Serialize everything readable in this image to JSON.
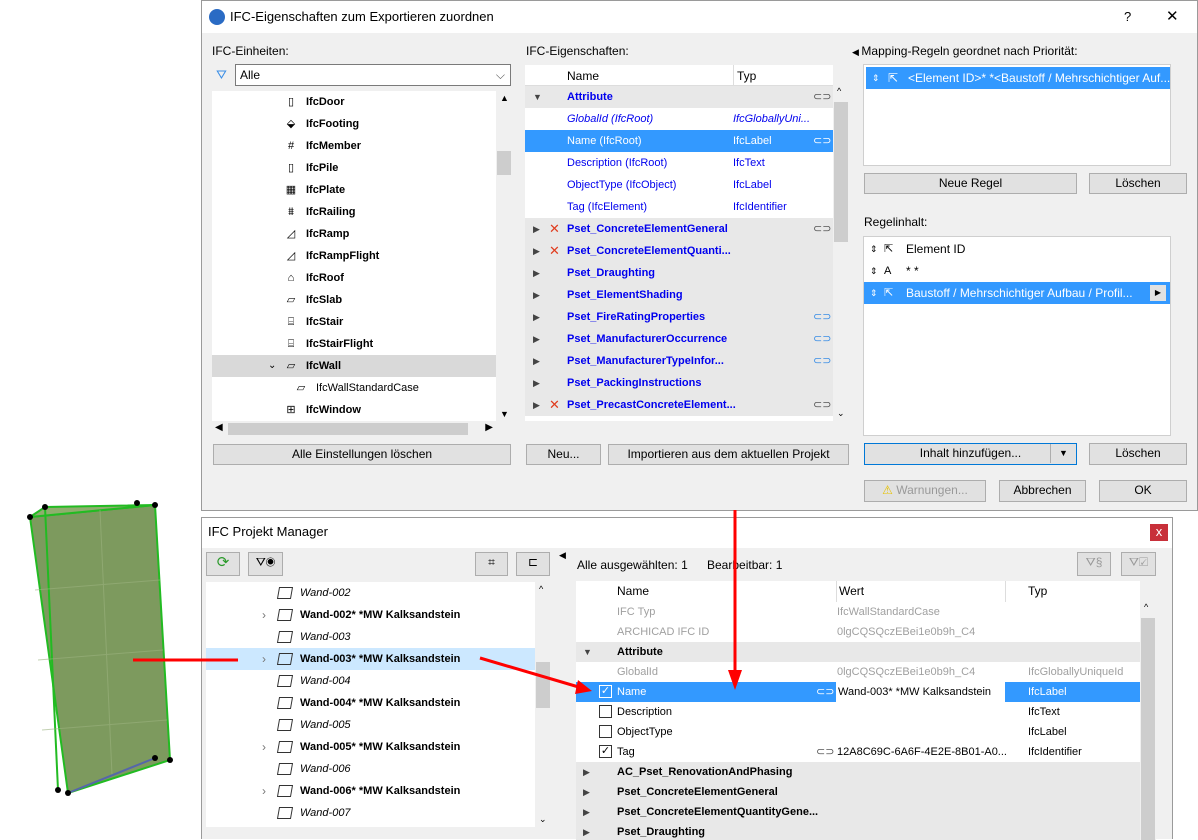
{
  "dialog1": {
    "title": "IFC-Eigenschaften zum Exportieren zuordnen",
    "help": "?",
    "close": "✕",
    "units": {
      "label": "IFC-Einheiten:",
      "filter_value": "Alle",
      "items": [
        {
          "label": "IfcDoor",
          "icon": "door-icon",
          "glyph": "▯"
        },
        {
          "label": "IfcFooting",
          "icon": "footing-icon",
          "glyph": "⬙"
        },
        {
          "label": "IfcMember",
          "icon": "member-icon",
          "glyph": "#"
        },
        {
          "label": "IfcPile",
          "icon": "pile-icon",
          "glyph": "▯"
        },
        {
          "label": "IfcPlate",
          "icon": "plate-icon",
          "glyph": "▦"
        },
        {
          "label": "IfcRailing",
          "icon": "railing-icon",
          "glyph": "⩩"
        },
        {
          "label": "IfcRamp",
          "icon": "ramp-icon",
          "glyph": "◿"
        },
        {
          "label": "IfcRampFlight",
          "icon": "ramp-flight-icon",
          "glyph": "◿"
        },
        {
          "label": "IfcRoof",
          "icon": "roof-icon",
          "glyph": "⌂"
        },
        {
          "label": "IfcSlab",
          "icon": "slab-icon",
          "glyph": "▱"
        },
        {
          "label": "IfcStair",
          "icon": "stair-icon",
          "glyph": "⌸"
        },
        {
          "label": "IfcStairFlight",
          "icon": "stair-flight-icon",
          "glyph": "⌸"
        },
        {
          "label": "IfcWall",
          "icon": "wall-icon",
          "glyph": "▱",
          "expanded": true,
          "selected": true
        },
        {
          "label": "IfcWallStandardCase",
          "icon": "wall-icon",
          "glyph": "▱",
          "child": true
        },
        {
          "label": "IfcWindow",
          "icon": "window-icon",
          "glyph": "⊞"
        }
      ],
      "clear_button": "Alle Einstellungen löschen"
    },
    "props": {
      "label": "IFC-Eigenschaften:",
      "col_name": "Name",
      "col_type": "Typ",
      "rows": [
        {
          "name": "Attribute",
          "type": "",
          "kind": "group",
          "open": true,
          "link": true
        },
        {
          "name": "GlobalId (IfcRoot)",
          "type": "IfcGloballyUni...",
          "kind": "italic"
        },
        {
          "name": "Name (IfcRoot)",
          "type": "IfcLabel",
          "kind": "selected",
          "link": true
        },
        {
          "name": "Description (IfcRoot)",
          "type": "IfcText",
          "kind": "item"
        },
        {
          "name": "ObjectType (IfcObject)",
          "type": "IfcLabel",
          "kind": "item"
        },
        {
          "name": "Tag (IfcElement)",
          "type": "IfcIdentifier",
          "kind": "item"
        },
        {
          "name": "Pset_ConcreteElementGeneral",
          "kind": "pset",
          "x": true,
          "link": true,
          "black": true
        },
        {
          "name": "Pset_ConcreteElementQuanti...",
          "kind": "pset",
          "x": true,
          "black": true
        },
        {
          "name": "Pset_Draughting",
          "kind": "pset"
        },
        {
          "name": "Pset_ElementShading",
          "kind": "pset"
        },
        {
          "name": "Pset_FireRatingProperties",
          "kind": "pset",
          "link": true,
          "bluelink": true
        },
        {
          "name": "Pset_ManufacturerOccurrence",
          "kind": "pset",
          "link": true,
          "bluelink": true
        },
        {
          "name": "Pset_ManufacturerTypeInfor...",
          "kind": "pset",
          "link": true,
          "bluelink": true
        },
        {
          "name": "Pset_PackingInstructions",
          "kind": "pset"
        },
        {
          "name": "Pset_PrecastConcreteElement...",
          "kind": "pset",
          "x": true,
          "link": true,
          "black": true
        }
      ],
      "new_button": "Neu...",
      "import_button": "Importieren aus dem aktuellen Projekt"
    },
    "rules": {
      "label": "Mapping-Regeln geordnet nach Priorität:",
      "selected_rule": "<Element ID>* *<Baustoff / Mehrschichtiger Auf...",
      "new_rule": "Neue Regel",
      "delete": "Löschen",
      "content_label": "Regelinhalt:",
      "content": [
        {
          "label": "Element ID",
          "icon": "cursor-icon",
          "glyph": "⇱"
        },
        {
          "label": "* *",
          "icon": "text-icon",
          "glyph": "A"
        },
        {
          "label": "Baustoff / Mehrschichtiger Aufbau / Profil...",
          "icon": "cursor-icon",
          "glyph": "⇱",
          "selected": true
        }
      ],
      "add_content": "Inhalt hinzufügen...",
      "delete2": "Löschen"
    },
    "footer": {
      "warnings": "Warnungen...",
      "cancel": "Abbrechen",
      "ok": "OK"
    }
  },
  "dialog2": {
    "title": "IFC Projekt Manager",
    "close": "x",
    "tree": [
      {
        "label": "Wand-002",
        "italic": true
      },
      {
        "label": "Wand-002* *MW Kalksandstein",
        "expand": true
      },
      {
        "label": "Wand-003",
        "italic": true
      },
      {
        "label": "Wand-003* *MW Kalksandstein",
        "expand": true,
        "selected": true
      },
      {
        "label": "Wand-004",
        "italic": true
      },
      {
        "label": "Wand-004* *MW Kalksandstein"
      },
      {
        "label": "Wand-005",
        "italic": true
      },
      {
        "label": "Wand-005* *MW Kalksandstein",
        "expand": true
      },
      {
        "label": "Wand-006",
        "italic": true
      },
      {
        "label": "Wand-006* *MW Kalksandstein",
        "expand": true
      },
      {
        "label": "Wand-007",
        "italic": true
      }
    ],
    "selected_count": "Alle ausgewählten: 1",
    "editable_count": "Bearbeitbar: 1",
    "cols": {
      "name": "Name",
      "value": "Wert",
      "type": "Typ"
    },
    "rows": [
      {
        "name": "IFC Typ",
        "value": "IfcWallStandardCase",
        "type": "",
        "kind": "gray"
      },
      {
        "name": "ARCHICAD IFC ID",
        "value": "0lgCQSQczEBei1e0b9h_C4",
        "type": "",
        "kind": "gray"
      },
      {
        "name": "Attribute",
        "kind": "group",
        "open": true
      },
      {
        "name": "GlobalId",
        "value": "0lgCQSQczEBei1e0b9h_C4",
        "type": "IfcGloballyUniqueId",
        "kind": "gray"
      },
      {
        "name": "Name",
        "value": "Wand-003* *MW Kalksandstein",
        "type": "IfcLabel",
        "kind": "selected",
        "checked": true,
        "link": true
      },
      {
        "name": "Description",
        "value": "",
        "type": "IfcText",
        "kind": "check",
        "checked": false
      },
      {
        "name": "ObjectType",
        "value": "",
        "type": "IfcLabel",
        "kind": "check",
        "checked": false
      },
      {
        "name": "Tag",
        "value": "12A8C69C-6A6F-4E2E-8B01-A0...",
        "type": "IfcIdentifier",
        "kind": "check",
        "checked": true,
        "link": true
      },
      {
        "name": "AC_Pset_RenovationAndPhasing",
        "kind": "group"
      },
      {
        "name": "Pset_ConcreteElementGeneral",
        "kind": "group"
      },
      {
        "name": "Pset_ConcreteElementQuantityGene...",
        "kind": "group"
      },
      {
        "name": "Pset_Draughting",
        "kind": "group"
      }
    ]
  },
  "colors": {
    "selection": "#3399ff",
    "tree_selection": "#cce8ff",
    "arrow": "#ff0000",
    "wall": "#7d9a5e",
    "wall_edge": "#22bb22"
  }
}
